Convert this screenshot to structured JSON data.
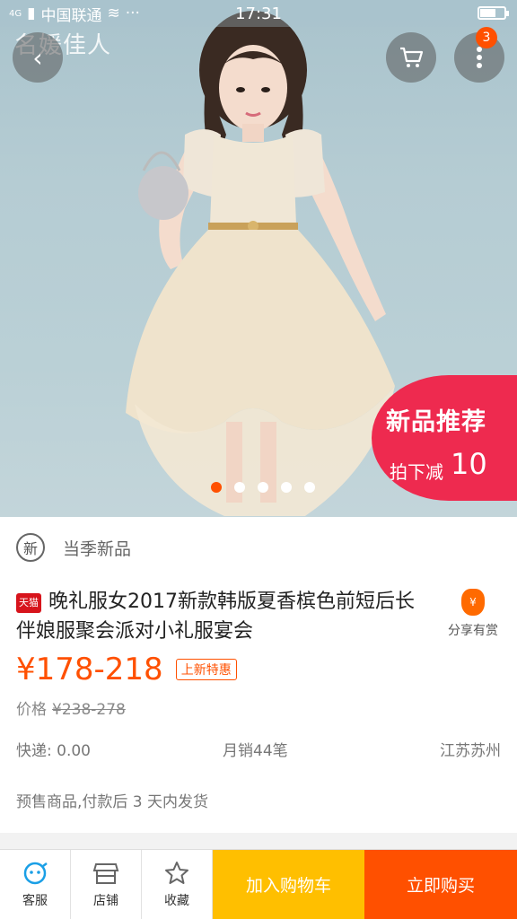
{
  "status": {
    "carrier": "中国联通",
    "time": "17:31",
    "network": "4G"
  },
  "brand_watermark": "名媛佳人",
  "header": {
    "cart_badge": "3"
  },
  "promo": {
    "line1": "新品推荐",
    "line2": "拍下减",
    "amount": "10"
  },
  "carousel": {
    "total": 5,
    "active": 1
  },
  "product": {
    "new_season_icon": "新",
    "new_season_label": "当季新品",
    "store_tag": "天猫",
    "title": "晚礼服女2017新款韩版夏香槟色前短后长伴娘服聚会派对小礼服宴会",
    "share_label": "分享有赏",
    "price": "¥178-218",
    "price_tag": "上新特惠",
    "original_label": "价格",
    "original_price": "¥238-278",
    "shipping": "快递: 0.00",
    "monthly_sales": "月销44笔",
    "location": "江苏苏州",
    "presale_note": "预售商品,付款后 3 天内发货"
  },
  "bottom": {
    "service": "客服",
    "store": "店铺",
    "favorite": "收藏",
    "add_to_cart": "加入购物车",
    "buy_now": "立即购买"
  },
  "colors": {
    "accent": "#ff5000",
    "cart_button": "#ffbf00",
    "promo_circle": "#ee2a4f"
  }
}
